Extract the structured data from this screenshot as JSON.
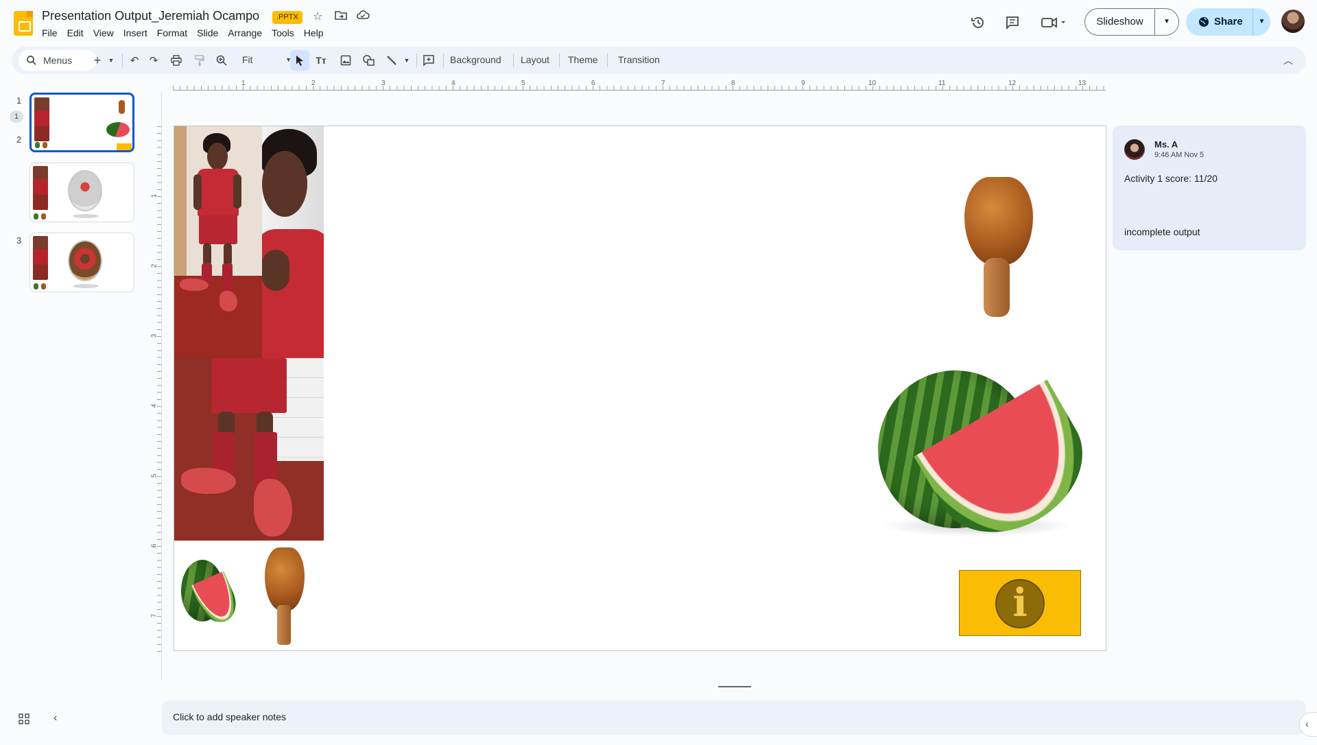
{
  "header": {
    "title": "Presentation Output_Jeremiah Ocampo",
    "badge": ".PPTX",
    "menus": [
      "File",
      "Edit",
      "View",
      "Insert",
      "Format",
      "Slide",
      "Arrange",
      "Tools",
      "Help"
    ],
    "slideshow_label": "Slideshow",
    "share_label": "Share"
  },
  "toolbar": {
    "search_label": "Menus",
    "zoom_label": "Fit",
    "background_label": "Background",
    "layout_label": "Layout",
    "theme_label": "Theme",
    "transition_label": "Transition"
  },
  "filmstrip": {
    "slides": [
      {
        "number": "1",
        "comment_count": "1"
      },
      {
        "number": "2"
      },
      {
        "number": "3"
      }
    ]
  },
  "ruler": {
    "horizontal": [
      "1",
      "2",
      "3",
      "4",
      "5",
      "6",
      "7",
      "8",
      "9",
      "10",
      "11",
      "12",
      "13"
    ],
    "vertical": [
      "1",
      "2",
      "3",
      "4",
      "5",
      "6",
      "7"
    ]
  },
  "comment": {
    "author": "Ms. A",
    "time": "9:46 AM Nov 5",
    "text": "Activity 1 score: 11/20",
    "text2": "incomplete output"
  },
  "notes": {
    "placeholder": "Click to add speaker notes"
  },
  "slide": {
    "info_symbol": "i"
  },
  "icons": {
    "star": "star-icon",
    "move": "folder-move-icon",
    "cloud": "cloud-status-icon",
    "history": "version-history-icon",
    "comments": "comments-icon",
    "meet": "meet-camera-icon"
  }
}
